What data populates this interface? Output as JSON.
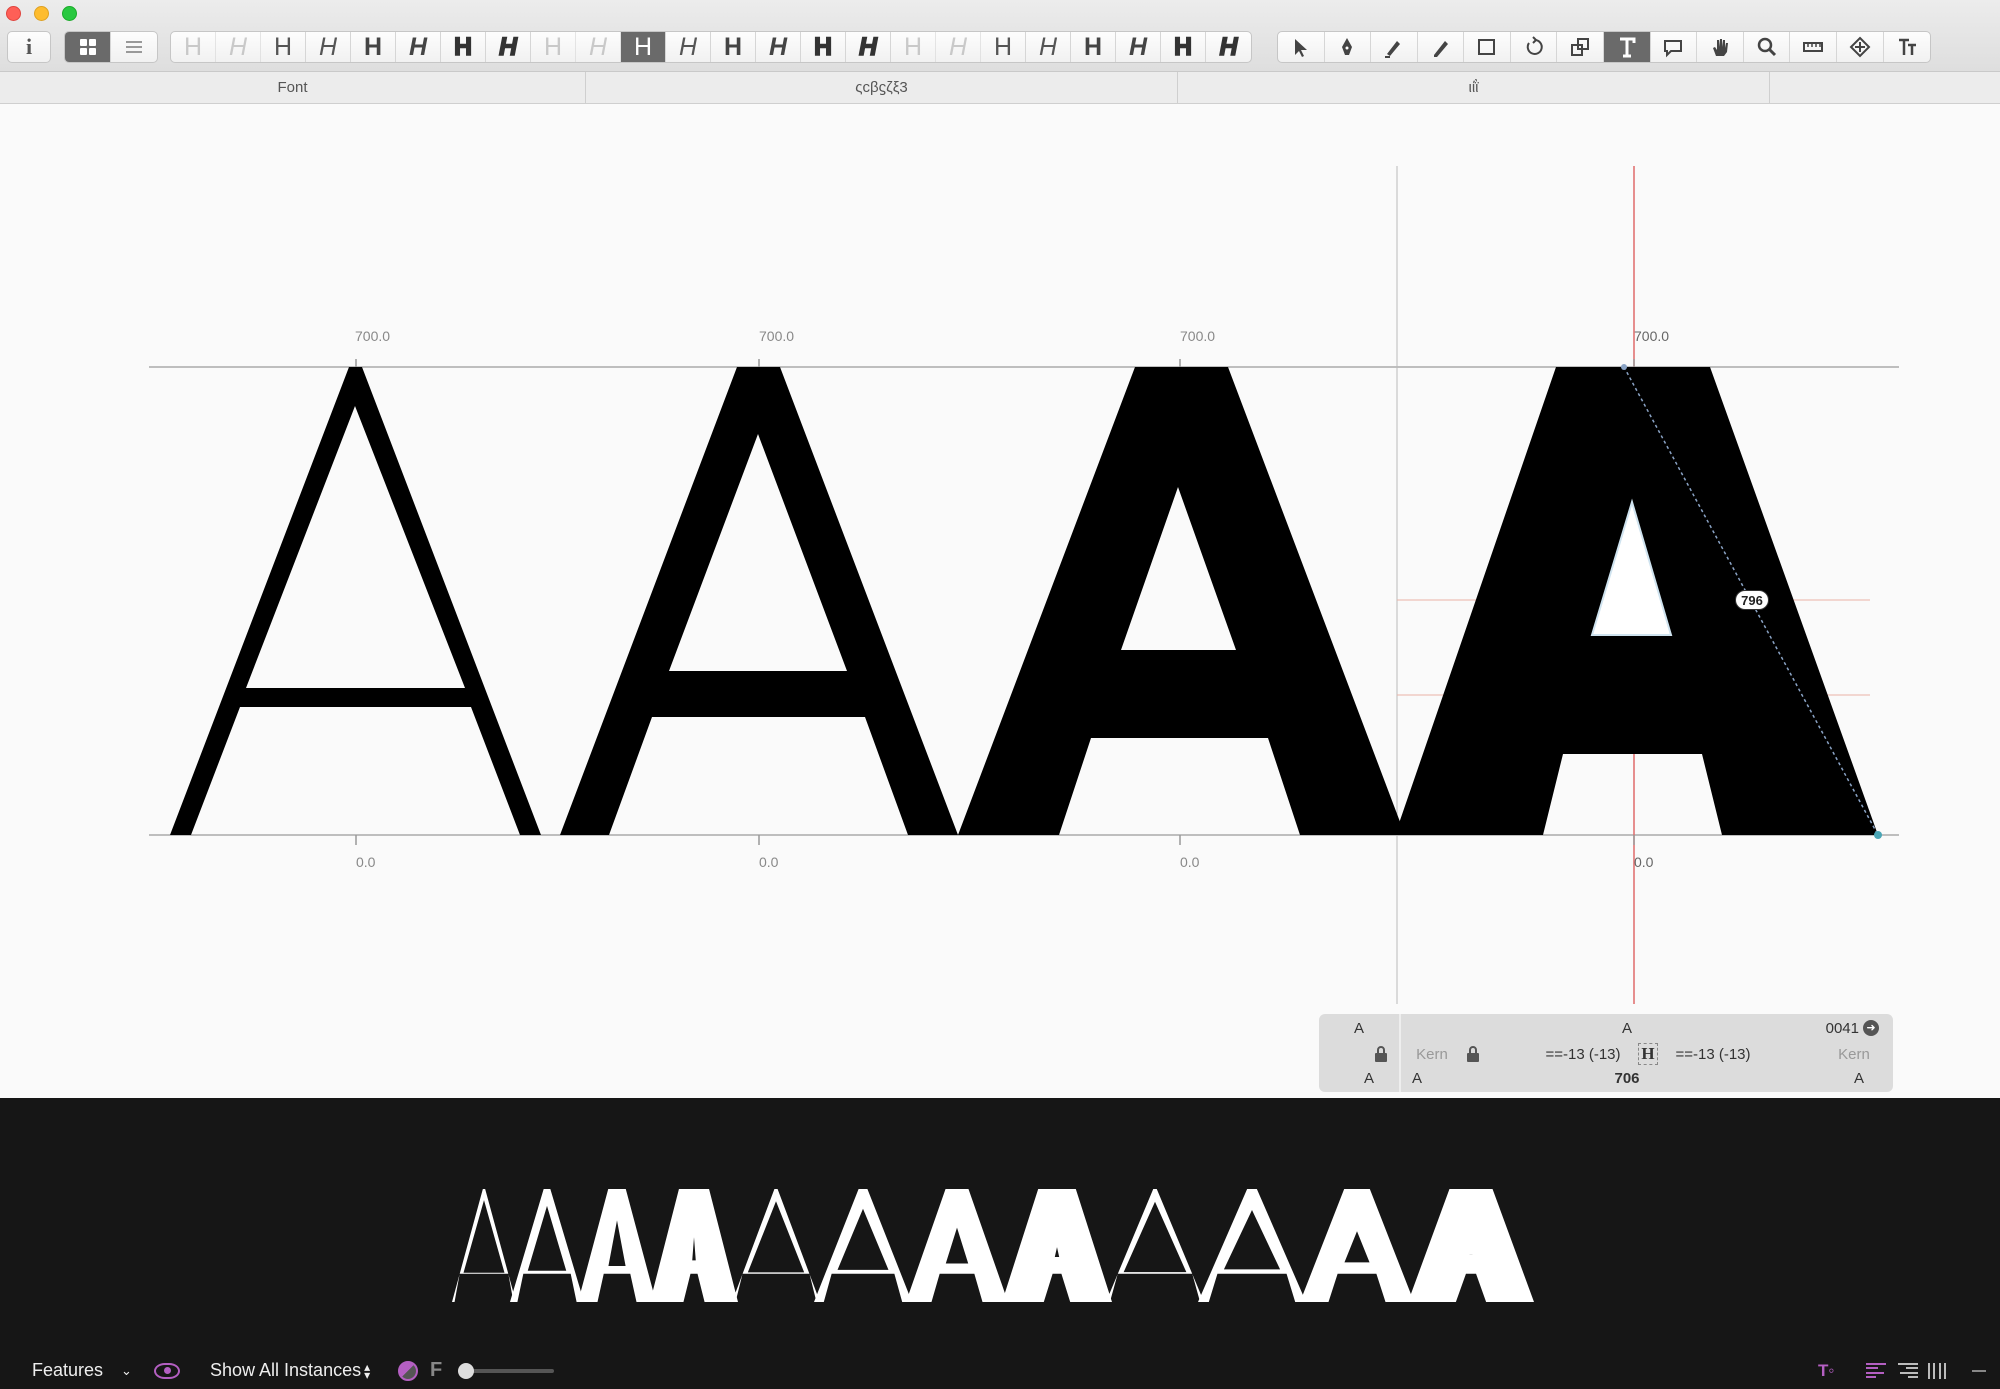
{
  "window": {
    "close_color": "#fe5f57",
    "minimize_color": "#febc2e",
    "zoom_color": "#28c840"
  },
  "toolbar": {
    "info_icon": "i",
    "view_grid_icon": "grid-icon",
    "view_list_icon": "list-icon",
    "instances": [
      {
        "glyph": "H",
        "style": "hairline"
      },
      {
        "glyph": "H",
        "style": "hairline-italic"
      },
      {
        "glyph": "H",
        "style": "light"
      },
      {
        "glyph": "H",
        "style": "light-italic"
      },
      {
        "glyph": "H",
        "style": "bold"
      },
      {
        "glyph": "H",
        "style": "bold-italic"
      },
      {
        "glyph": "H",
        "style": "black"
      },
      {
        "glyph": "H",
        "style": "black-italic"
      },
      {
        "glyph": "H",
        "style": "hairline"
      },
      {
        "glyph": "H",
        "style": "hairline-italic"
      },
      {
        "glyph": "H",
        "style": "light",
        "selected": true
      },
      {
        "glyph": "H",
        "style": "light-italic"
      },
      {
        "glyph": "H",
        "style": "bold"
      },
      {
        "glyph": "H",
        "style": "bold-italic"
      },
      {
        "glyph": "H",
        "style": "black"
      },
      {
        "glyph": "H",
        "style": "black-italic"
      },
      {
        "glyph": "H",
        "style": "hairline"
      },
      {
        "glyph": "H",
        "style": "hairline-italic"
      },
      {
        "glyph": "H",
        "style": "light"
      },
      {
        "glyph": "H",
        "style": "light-italic"
      },
      {
        "glyph": "H",
        "style": "bold"
      },
      {
        "glyph": "H",
        "style": "bold-italic"
      },
      {
        "glyph": "H",
        "style": "black"
      },
      {
        "glyph": "H",
        "style": "black-italic"
      }
    ],
    "tools": [
      "select-tool-icon",
      "pen-tool-icon",
      "draw-tool-icon",
      "pencil-tool-icon",
      "rectangle-tool-icon",
      "rotate-tool-icon",
      "scale-tool-icon",
      "text-tool-icon",
      "annotation-tool-icon",
      "hand-tool-icon",
      "zoom-tool-icon",
      "measure-tool-icon",
      "component-tool-icon",
      "typeset-tool-icon"
    ]
  },
  "tabs": [
    "Font",
    "ςϲβϛζξ3",
    "ιίῒ"
  ],
  "canvas": {
    "metrics": {
      "top_values": [
        "700.0",
        "700.0",
        "700.0",
        "700.0"
      ],
      "bottom_values": [
        "0.0",
        "0.0",
        "0.0",
        "0.0"
      ]
    },
    "measure_badge": "796"
  },
  "info_panel": {
    "left_glyph": "A",
    "center_glyph": "A",
    "unicode": "0041",
    "kern_left_label": "Kern",
    "kern_right_label": "Kern",
    "lsb": "==-13 (-13)",
    "rsb": "==-13 (-13)",
    "left_group": "A",
    "left_name": "A",
    "width": "706",
    "right_name": "A"
  },
  "preview": {
    "text": "AAAAAAAAAAAA"
  },
  "bottombar": {
    "features_label": "Features",
    "instances_label": "Show All Instances",
    "f_label": "F",
    "slider_value": 0
  }
}
